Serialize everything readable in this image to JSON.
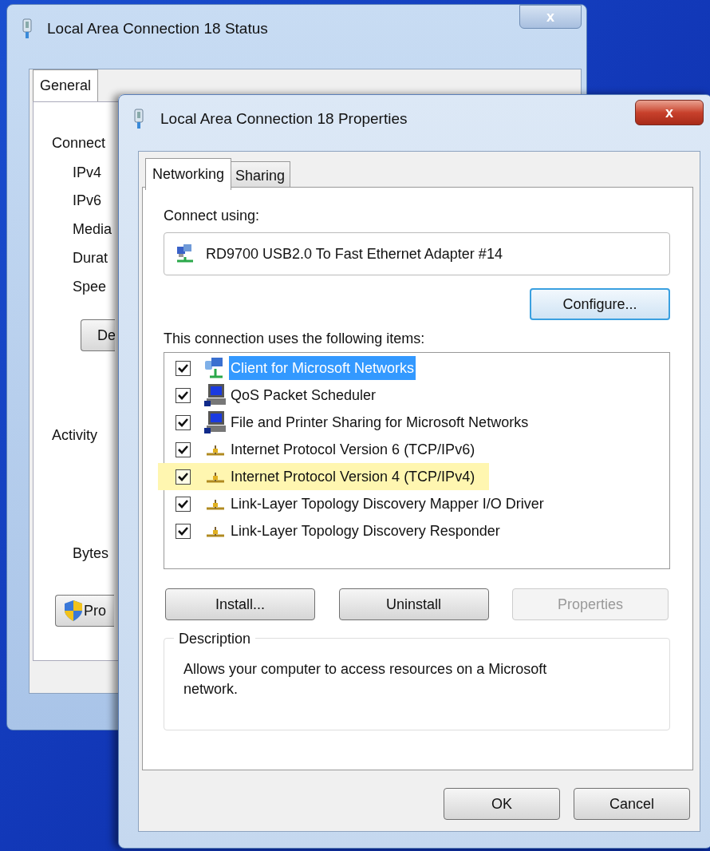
{
  "back_window": {
    "title": "Local Area Connection 18 Status",
    "close": "x",
    "tabs": [
      {
        "label": "General",
        "selected": true
      }
    ],
    "labels": [
      {
        "kind": "heading",
        "text": "Connect"
      },
      {
        "kind": "field",
        "text": "IPv4"
      },
      {
        "kind": "field",
        "text": "IPv6"
      },
      {
        "kind": "field",
        "text": "Media"
      },
      {
        "kind": "field",
        "text": "Durat"
      },
      {
        "kind": "field",
        "text": "Spee"
      },
      {
        "kind": "button",
        "text": "De"
      },
      {
        "kind": "heading",
        "text": "Activity"
      },
      {
        "kind": "field",
        "text": "Bytes"
      },
      {
        "kind": "shield_button",
        "text": "Pro"
      }
    ]
  },
  "front_window": {
    "title": "Local Area Connection 18 Properties",
    "close": "x",
    "tabs": [
      {
        "label": "Networking",
        "selected": true
      },
      {
        "label": "Sharing",
        "selected": false
      }
    ],
    "connect_using_label": "Connect using:",
    "adapter": "RD9700 USB2.0 To Fast Ethernet Adapter #14",
    "configure_button": "Configure...",
    "items_label": "This connection uses the following items:",
    "items": [
      {
        "kind": "client",
        "label": "Client for Microsoft Networks",
        "checked": true,
        "selected": true,
        "highlighted": false
      },
      {
        "kind": "service",
        "label": "QoS Packet Scheduler",
        "checked": true,
        "selected": false,
        "highlighted": false
      },
      {
        "kind": "service",
        "label": "File and Printer Sharing for Microsoft Networks",
        "checked": true,
        "selected": false,
        "highlighted": false
      },
      {
        "kind": "protocol",
        "label": "Internet Protocol Version 6 (TCP/IPv6)",
        "checked": true,
        "selected": false,
        "highlighted": false
      },
      {
        "kind": "protocol",
        "label": "Internet Protocol Version 4 (TCP/IPv4)",
        "checked": true,
        "selected": false,
        "highlighted": true
      },
      {
        "kind": "protocol",
        "label": "Link-Layer Topology Discovery Mapper I/O Driver",
        "checked": true,
        "selected": false,
        "highlighted": false
      },
      {
        "kind": "protocol",
        "label": "Link-Layer Topology Discovery Responder",
        "checked": true,
        "selected": false,
        "highlighted": false
      }
    ],
    "buttons": [
      {
        "label": "Install...",
        "disabled": false
      },
      {
        "label": "Uninstall",
        "disabled": false
      },
      {
        "label": "Properties",
        "disabled": true
      }
    ],
    "description": {
      "legend": "Description",
      "text": "Allows your computer to access resources on a Microsoft network."
    },
    "footer_buttons": [
      {
        "label": "OK"
      },
      {
        "label": "Cancel"
      }
    ]
  }
}
